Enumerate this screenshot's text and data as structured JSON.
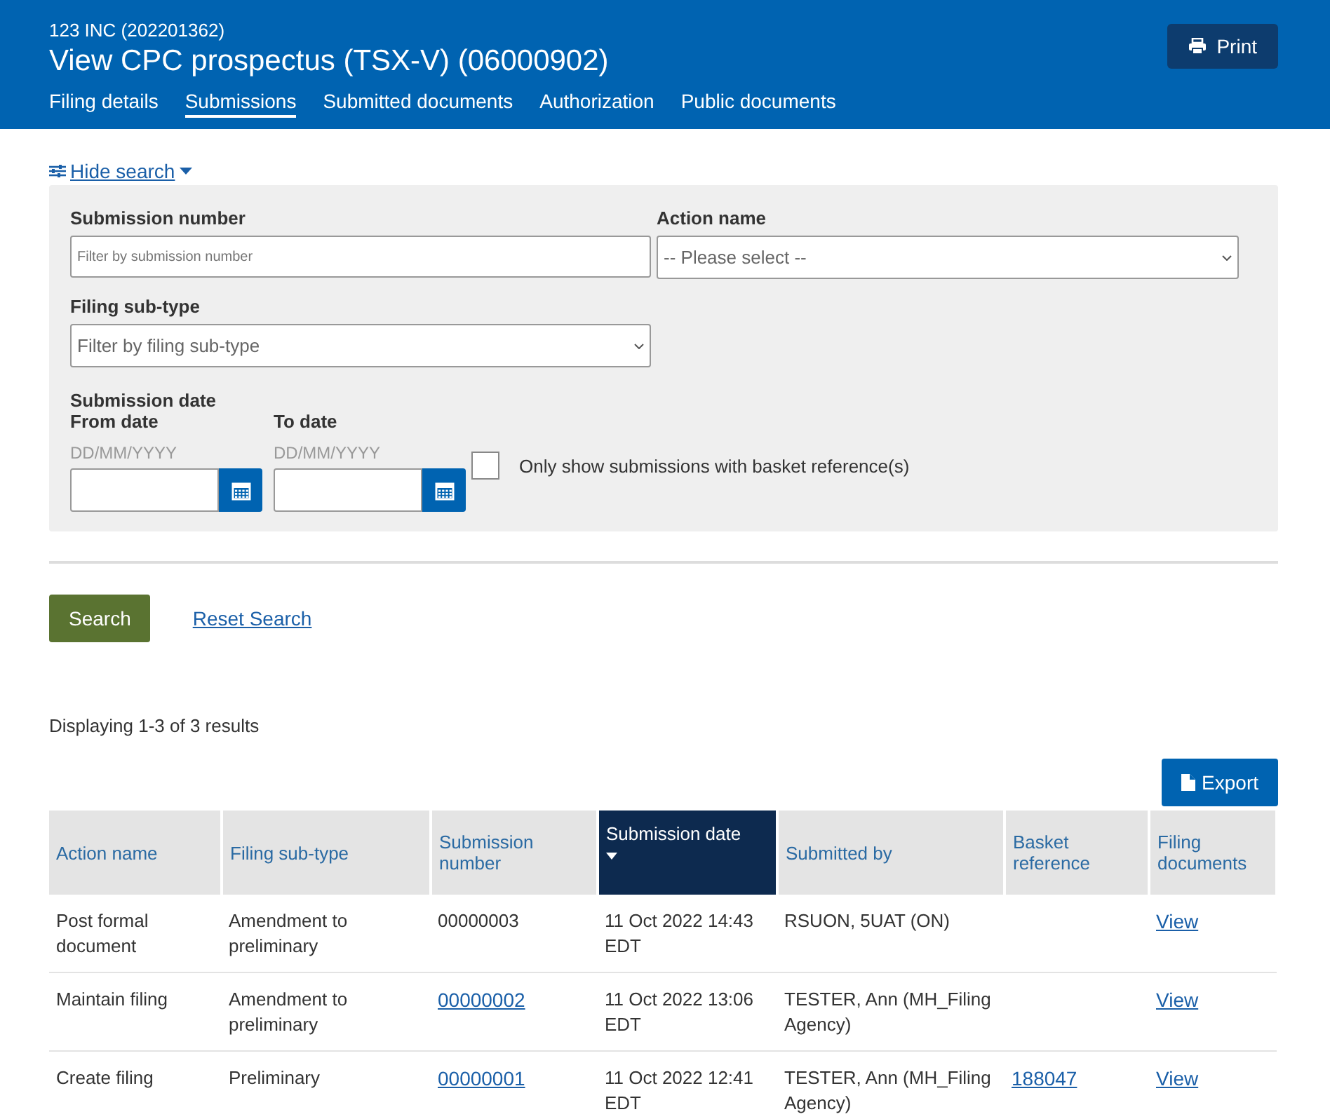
{
  "header": {
    "subtitle": "123 INC (202201362)",
    "title": "View CPC prospectus (TSX-V) (06000902)",
    "print_button": "Print"
  },
  "tabs": [
    {
      "label": "Filing details",
      "selected": false
    },
    {
      "label": "Submissions",
      "selected": true
    },
    {
      "label": "Submitted documents",
      "selected": false
    },
    {
      "label": "Authorization",
      "selected": false
    },
    {
      "label": "Public documents",
      "selected": false
    }
  ],
  "search_toggle": {
    "label": "Hide search",
    "expanded": true
  },
  "search": {
    "submission_number": {
      "label": "Submission number",
      "placeholder": "Filter by submission number"
    },
    "action_name": {
      "label": "Action name",
      "value": "-- Please select --"
    },
    "filing_sub_type": {
      "label": "Filing sub-type",
      "value": "Filter by filing sub-type"
    },
    "date_heading": "Submission date",
    "from_date": {
      "label": "From date",
      "hint": "DD/MM/YYYY"
    },
    "to_date": {
      "label": "To date",
      "hint": "DD/MM/YYYY"
    },
    "basket_only": {
      "label": "Only show submissions with basket reference(s)",
      "checked": false
    }
  },
  "search_button": "Search",
  "reset_link": "Reset Search",
  "result_count": "Displaying 1-3 of 3 results",
  "export_button": "Export",
  "table": {
    "columns": [
      {
        "label": "Action name",
        "sorted": false
      },
      {
        "label": "Filing sub-type",
        "sorted": false
      },
      {
        "label": "Submission number",
        "sorted": false
      },
      {
        "label": "Submission date",
        "sorted": true
      },
      {
        "label": "Submitted by",
        "sorted": false
      },
      {
        "label": "Basket reference",
        "sorted": false
      },
      {
        "label": "Filing documents",
        "sorted": false
      }
    ],
    "rows": [
      [
        {
          "text": "Post formal document",
          "link": false
        },
        {
          "text": "Amendment to preliminary",
          "link": false
        },
        {
          "text": "00000003",
          "link": false
        },
        {
          "text": "11 Oct 2022 14:43 EDT",
          "link": false
        },
        {
          "text": "RSUON, 5UAT (ON)",
          "link": false
        },
        null,
        {
          "text": "View",
          "link": true
        }
      ],
      [
        {
          "text": "Maintain filing",
          "link": false
        },
        {
          "text": "Amendment to preliminary",
          "link": false
        },
        {
          "text": "00000002",
          "link": true
        },
        {
          "text": "11 Oct 2022 13:06 EDT",
          "link": false
        },
        {
          "text": "TESTER, Ann (MH_Filing Agency)",
          "link": false
        },
        null,
        {
          "text": "View",
          "link": true
        }
      ],
      [
        {
          "text": "Create filing",
          "link": false
        },
        {
          "text": "Preliminary",
          "link": false
        },
        {
          "text": "00000001",
          "link": true
        },
        {
          "text": "11 Oct 2022 12:41 EDT",
          "link": false
        },
        {
          "text": "TESTER, Ann (MH_Filing Agency)",
          "link": false
        },
        {
          "text": "188047",
          "link": true
        },
        {
          "text": "View",
          "link": true
        }
      ]
    ]
  }
}
